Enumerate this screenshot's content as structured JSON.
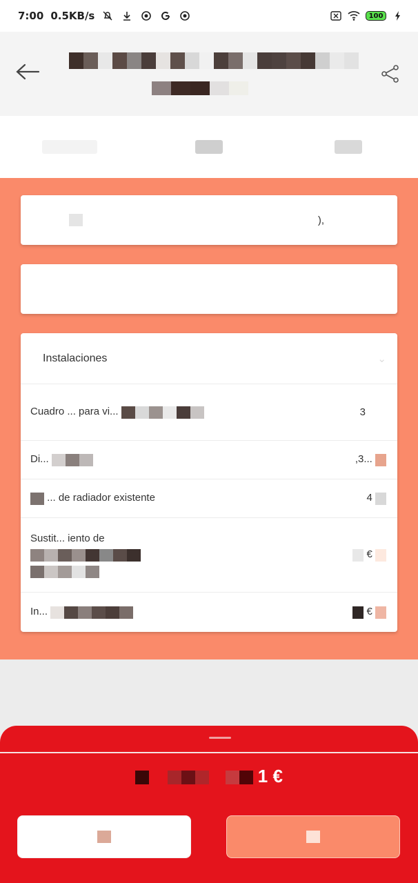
{
  "status_bar": {
    "time": "7:00",
    "speed": "0.5KB/s",
    "battery": "100"
  },
  "header": {
    "title_line1": "",
    "title_line2": ""
  },
  "tabs": [
    {
      "label": ""
    },
    {
      "label": ""
    },
    {
      "label": ""
    }
  ],
  "cards": {
    "card1": {
      "left": "",
      "right": "),"
    },
    "card2": {
      "left": "",
      "right": ""
    },
    "section": {
      "title": "Instalaciones",
      "rows": [
        {
          "left": "Cuadro ... para vi...",
          "right": "3"
        },
        {
          "left": "Di...",
          "right": ",3..."
        },
        {
          "left": "... de radiador existente",
          "right": "4"
        },
        {
          "left": "Sustit... iento de",
          "right": "€"
        },
        {
          "left": "In...",
          "right": "€"
        }
      ]
    }
  },
  "sheet": {
    "total": "1 €",
    "left_button": "",
    "right_button": ""
  },
  "colors": {
    "accent_orange": "#fa8a6a",
    "brand_red": "#e4141c"
  }
}
